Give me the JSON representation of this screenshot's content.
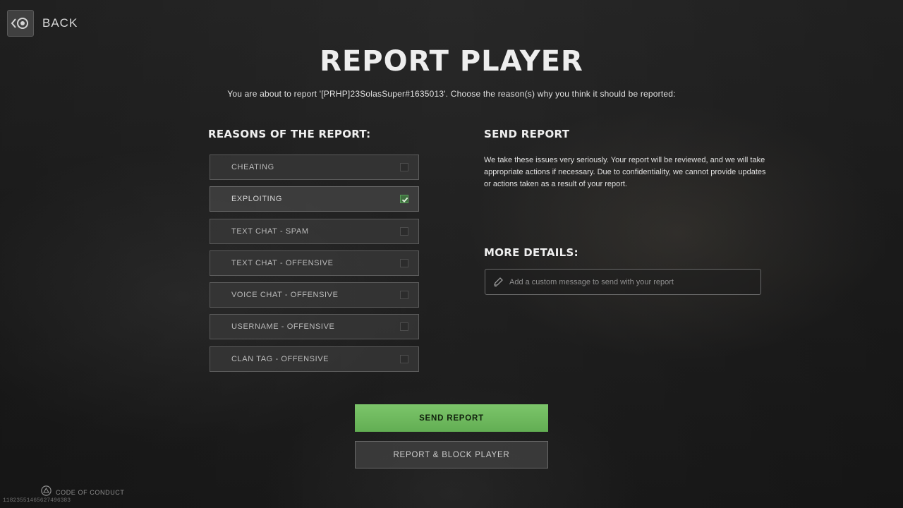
{
  "nav": {
    "back_label": "BACK"
  },
  "header": {
    "title": "REPORT PLAYER",
    "subtitle": "You are about to report '[PRHP]23SolasSuper#1635013'. Choose the reason(s) why you think it should be reported:"
  },
  "reasons": {
    "heading": "REASONS OF THE REPORT:",
    "items": [
      {
        "label": "CHEATING",
        "checked": false
      },
      {
        "label": "EXPLOITING",
        "checked": true
      },
      {
        "label": "TEXT CHAT - SPAM",
        "checked": false
      },
      {
        "label": "TEXT CHAT - OFFENSIVE",
        "checked": false
      },
      {
        "label": "VOICE CHAT - OFFENSIVE",
        "checked": false
      },
      {
        "label": "USERNAME - OFFENSIVE",
        "checked": false
      },
      {
        "label": "CLAN TAG - OFFENSIVE",
        "checked": false
      }
    ]
  },
  "send_report": {
    "heading": "SEND REPORT",
    "description": "We take these issues very seriously. Your report will be reviewed, and we will take appropriate actions if necessary. Due to confidentiality, we cannot provide updates or actions taken as a result of your report."
  },
  "more_details": {
    "heading": "MORE DETAILS:",
    "value": "",
    "placeholder": "Add a custom message to send with your report"
  },
  "actions": {
    "send_label": "SEND REPORT",
    "block_label": "REPORT & BLOCK PLAYER"
  },
  "footer": {
    "code_of_conduct": "CODE OF CONDUCT",
    "build_id": "11823551465627496383"
  },
  "colors": {
    "accent_green": "#6ab85a",
    "check_green": "#58a058"
  },
  "icons": {
    "back": "back-arrow-icon",
    "check": "checkmark-icon",
    "pencil": "pencil-icon",
    "conduct": "triangle-button-icon"
  }
}
